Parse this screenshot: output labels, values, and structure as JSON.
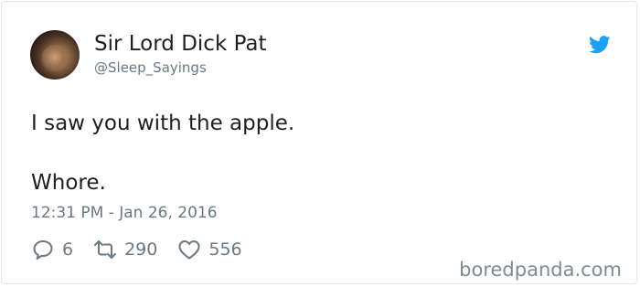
{
  "user": {
    "display_name": "Sir Lord Dick Pat",
    "handle": "@Sleep_Sayings"
  },
  "tweet": {
    "line1": "I saw you with the apple.",
    "line2": "Whore.",
    "timestamp": "12:31 PM - Jan 26, 2016"
  },
  "stats": {
    "replies": "6",
    "retweets": "290",
    "likes": "556"
  },
  "watermark": "boredpanda.com",
  "colors": {
    "twitter_blue": "#1da1f2",
    "muted_text": "#697882",
    "primary_text": "#1c2022"
  }
}
